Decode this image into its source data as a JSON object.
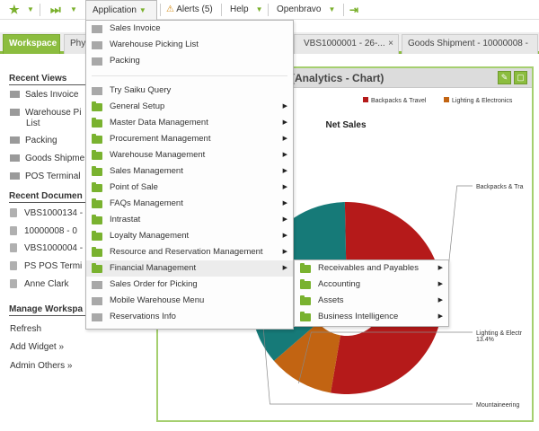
{
  "topbar": {
    "application_label": "Application",
    "alerts_label": "Alerts (5)",
    "help_label": "Help",
    "openbravo_label": "Openbravo"
  },
  "tabs": [
    {
      "label": "Workspace"
    },
    {
      "label": "Phy"
    },
    {
      "label": "VBS1000001 - 26-..."
    },
    {
      "label": "Goods Shipment - 10000008 -"
    }
  ],
  "left_panel": {
    "recent_views_title": "Recent Views",
    "recent_views": [
      {
        "label": "Sales Invoice"
      },
      {
        "label": "Warehouse Pi"
      },
      {
        "label": "List"
      },
      {
        "label": "Packing"
      },
      {
        "label": "Goods Shipme"
      },
      {
        "label": "POS Terminal"
      }
    ],
    "recent_documents_title": "Recent Documen",
    "recent_documents": [
      {
        "label": "VBS1000134 -"
      },
      {
        "label": "10000008 - 0"
      },
      {
        "label": "VBS1000004 -"
      },
      {
        "label": "PS POS Termi"
      },
      {
        "label": "Anne Clark"
      }
    ],
    "manage_title": "Manage Workspa",
    "manage_links": [
      {
        "label": "Refresh"
      },
      {
        "label": "Add Widget »"
      },
      {
        "label": "Admin Others »"
      }
    ]
  },
  "widget": {
    "title": "y (Analytics - Chart)"
  },
  "app_menu": {
    "items": [
      {
        "label": "Sales Invoice",
        "icon": "document-icon",
        "submenu": false
      },
      {
        "label": "Warehouse Picking List",
        "icon": "document-icon",
        "submenu": false
      },
      {
        "label": "Packing",
        "icon": "document-icon",
        "submenu": false
      },
      {
        "label": "Try Saiku Query",
        "icon": "document-icon",
        "submenu": false
      },
      {
        "label": "General Setup",
        "icon": "folder-icon",
        "submenu": true
      },
      {
        "label": "Master Data Management",
        "icon": "folder-icon",
        "submenu": true
      },
      {
        "label": "Procurement Management",
        "icon": "folder-icon",
        "submenu": true
      },
      {
        "label": "Warehouse Management",
        "icon": "folder-icon",
        "submenu": true
      },
      {
        "label": "Sales Management",
        "icon": "folder-icon",
        "submenu": true
      },
      {
        "label": "Point of Sale",
        "icon": "folder-icon",
        "submenu": true
      },
      {
        "label": "FAQs Management",
        "icon": "folder-icon",
        "submenu": true
      },
      {
        "label": "Intrastat",
        "icon": "folder-icon",
        "submenu": true
      },
      {
        "label": "Loyalty Management",
        "icon": "folder-icon",
        "submenu": true
      },
      {
        "label": "Resource and Reservation Management",
        "icon": "folder-icon",
        "submenu": true
      },
      {
        "label": "Financial Management",
        "icon": "folder-icon",
        "submenu": true,
        "highlighted": true
      },
      {
        "label": "Sales Order for Picking",
        "icon": "document-icon",
        "submenu": false
      },
      {
        "label": "Mobile Warehouse Menu",
        "icon": "document-icon",
        "submenu": false
      },
      {
        "label": "Reservations Info",
        "icon": "document-icon",
        "submenu": false
      }
    ]
  },
  "sub_menu": {
    "items": [
      {
        "label": "Receivables and Payables"
      },
      {
        "label": "Accounting"
      },
      {
        "label": "Assets"
      },
      {
        "label": "Business Intelligence"
      }
    ]
  },
  "colors": {
    "accent_green": "#8cbd3f",
    "folder_green": "#79b22f"
  },
  "chart_data": {
    "type": "pie",
    "title": "Net Sales",
    "legend": [
      "Backpacks & Travel",
      "Lighting & Electronics"
    ],
    "legend_position": "top-right",
    "slices": [
      {
        "name": "Backpacks & Travel",
        "share": 0.53,
        "color": "#b51a1a",
        "label": "Backpacks & Tra"
      },
      {
        "name": "Lighting & Electronics",
        "share": 0.11,
        "color": "#c26412",
        "label": "Lighting & Electr",
        "value_label": "13.4%"
      },
      {
        "name": "Mountaineering",
        "share": 0.36,
        "color": "#167a78",
        "label": "Mountaineering"
      }
    ]
  }
}
